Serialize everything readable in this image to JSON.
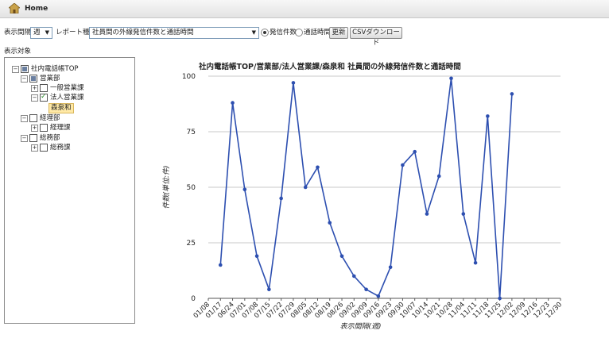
{
  "header": {
    "home_label": "Home"
  },
  "controls": {
    "unit_label": "表示間隔",
    "unit_value": "週",
    "report_label": "レポート種別",
    "report_value": "社員間の外線発信件数と通話時間",
    "radio_count": "発信件数",
    "radio_time": "通話時間",
    "update_button": "更新",
    "csv_button": "CSVダウンロード"
  },
  "tree": {
    "panel_label": "表示対象",
    "nodes": [
      {
        "label": "社内電話帳TOP"
      },
      {
        "label": "営業部"
      },
      {
        "label": "一般営業課"
      },
      {
        "label": "法人営業課"
      },
      {
        "label": "森泉和"
      },
      {
        "label": "経理部"
      },
      {
        "label": "経理課"
      },
      {
        "label": "総務部"
      },
      {
        "label": "総務課"
      }
    ]
  },
  "chart_data": {
    "type": "line",
    "title": "社内電話帳TOP/営業部/法人営業課/森泉和 社員間の外線発信件数と通話時間",
    "xlabel": "表示間隔(週)",
    "ylabel": "件数(単位:件)",
    "ylim": [
      0,
      100
    ],
    "yticks": [
      "0",
      "25",
      "50",
      "75",
      "100"
    ],
    "grid": true,
    "categories": [
      "01/08",
      "01/17",
      "06/24",
      "07/01",
      "07/08",
      "07/15",
      "07/22",
      "07/29",
      "08/05",
      "08/12",
      "08/19",
      "08/26",
      "09/02",
      "09/09",
      "09/16",
      "09/23",
      "09/30",
      "10/07",
      "10/14",
      "10/21",
      "10/28",
      "11/04",
      "11/11",
      "11/18",
      "11/25",
      "12/02",
      "12/09",
      "12/16",
      "12/23",
      "12/30"
    ],
    "series": [
      {
        "color": "#2d4fb0",
        "values": [
          null,
          15,
          88,
          49,
          19,
          4,
          45,
          97,
          50,
          59,
          34,
          19,
          10,
          4,
          1,
          14,
          60,
          66,
          38,
          55,
          99,
          38,
          16,
          82,
          0,
          92,
          null,
          null,
          null,
          null
        ]
      }
    ]
  }
}
